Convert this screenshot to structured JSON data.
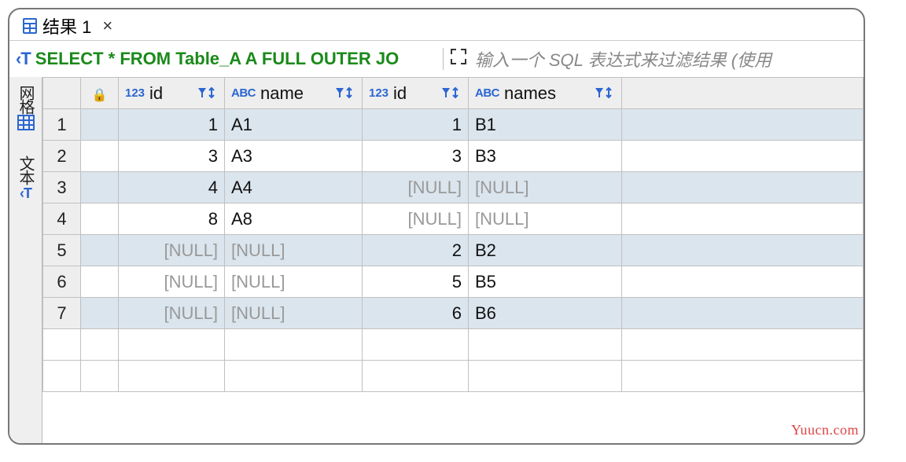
{
  "tab": {
    "title": "结果 1"
  },
  "toolbar": {
    "sql_prefix": "‹T",
    "sql_text": "SELECT * FROM Table_A A FULL OUTER JO",
    "filter_placeholder": "输入一个 SQL 表达式来过滤结果 (使用"
  },
  "sidebar": {
    "grid_label": "网格",
    "text_label": "文本"
  },
  "columns": [
    {
      "type": "123",
      "label": "id"
    },
    {
      "type": "ABC",
      "label": "name"
    },
    {
      "type": "123",
      "label": "id"
    },
    {
      "type": "ABC",
      "label": "names"
    }
  ],
  "null_label": "[NULL]",
  "rows": [
    {
      "n": "1",
      "c0": "1",
      "c1": "A1",
      "c2": "1",
      "c3": "B1",
      "null0": false,
      "null1": false,
      "null2": false,
      "null3": false
    },
    {
      "n": "2",
      "c0": "3",
      "c1": "A3",
      "c2": "3",
      "c3": "B3",
      "null0": false,
      "null1": false,
      "null2": false,
      "null3": false
    },
    {
      "n": "3",
      "c0": "4",
      "c1": "A4",
      "c2": "[NULL]",
      "c3": "[NULL]",
      "null0": false,
      "null1": false,
      "null2": true,
      "null3": true
    },
    {
      "n": "4",
      "c0": "8",
      "c1": "A8",
      "c2": "[NULL]",
      "c3": "[NULL]",
      "null0": false,
      "null1": false,
      "null2": true,
      "null3": true
    },
    {
      "n": "5",
      "c0": "[NULL]",
      "c1": "[NULL]",
      "c2": "2",
      "c3": "B2",
      "null0": true,
      "null1": true,
      "null2": false,
      "null3": false
    },
    {
      "n": "6",
      "c0": "[NULL]",
      "c1": "[NULL]",
      "c2": "5",
      "c3": "B5",
      "null0": true,
      "null1": true,
      "null2": false,
      "null3": false
    },
    {
      "n": "7",
      "c0": "[NULL]",
      "c1": "[NULL]",
      "c2": "6",
      "c3": "B6",
      "null0": true,
      "null1": true,
      "null2": false,
      "null3": false
    }
  ],
  "watermark": "Yuucn.com"
}
